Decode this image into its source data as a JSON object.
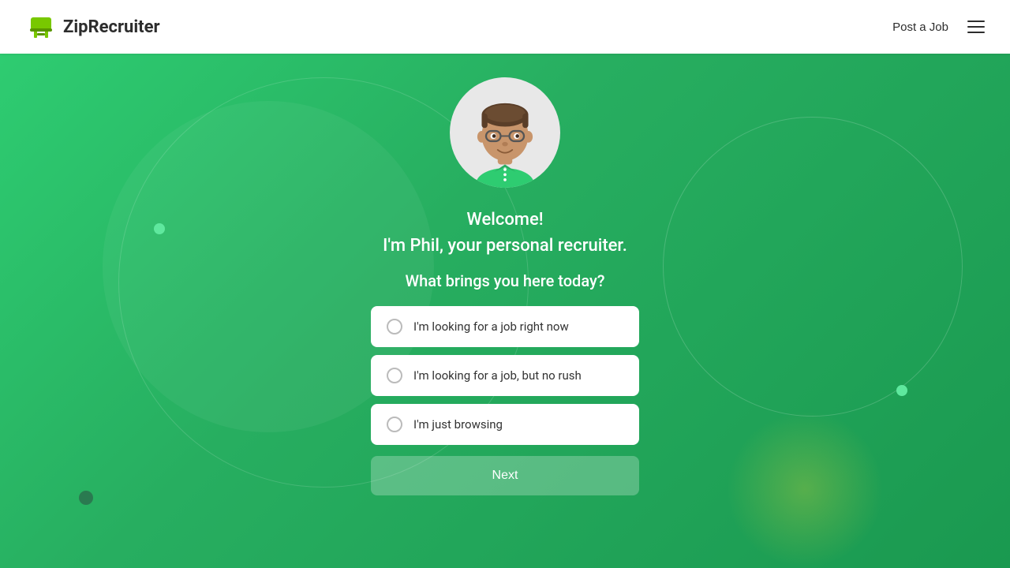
{
  "header": {
    "logo_text": "ZipRecruiter",
    "post_job_label": "Post a Job"
  },
  "main": {
    "avatar_alt": "Phil the recruiter",
    "welcome_line1": "Welcome!",
    "welcome_line2": "I'm Phil, your personal recruiter.",
    "question": "What brings you here today?",
    "options": [
      {
        "id": "opt1",
        "label": "I'm looking for a job right now"
      },
      {
        "id": "opt2",
        "label": "I'm looking for a job, but no rush"
      },
      {
        "id": "opt3",
        "label": "I'm just browsing"
      }
    ],
    "next_button_label": "Next"
  }
}
